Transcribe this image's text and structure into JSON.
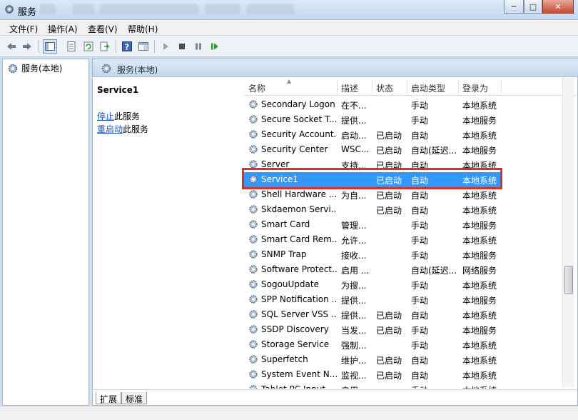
{
  "window": {
    "title": "服务",
    "controls": {
      "minimize": "─",
      "maximize": "□",
      "close": "✕"
    }
  },
  "menu": [
    "文件(F)",
    "操作(A)",
    "查看(V)",
    "帮助(H)"
  ],
  "toolbar": {
    "icons": [
      "back-icon",
      "forward-icon",
      "show-tree-icon",
      "properties-icon",
      "refresh-icon",
      "export-icon",
      "help-icon",
      "view-icon",
      "start-service-icon",
      "stop-service-icon",
      "pause-service-icon",
      "restart-service-icon"
    ]
  },
  "tree": {
    "root_label": "服务(本地)"
  },
  "panel": {
    "header": "服务(本地)",
    "selected_title": "Service1",
    "stop_link": "停止",
    "stop_suffix": "此服务",
    "restart_link": "重启动",
    "restart_suffix": "此服务"
  },
  "columns": [
    "名称",
    "描述",
    "状态",
    "启动类型",
    "登录为"
  ],
  "rows": [
    [
      "Secondary Logon",
      "在不...",
      "",
      "手动",
      "本地系统"
    ],
    [
      "Secure Socket T...",
      "提供...",
      "",
      "手动",
      "本地服务"
    ],
    [
      "Security Account...",
      "启动...",
      "已启动",
      "自动",
      "本地系统"
    ],
    [
      "Security Center",
      "WSC...",
      "已启动",
      "自动(延迟...",
      "本地服务"
    ],
    [
      "Server",
      "支持...",
      "已启动",
      "自动",
      "本地系统"
    ],
    [
      "Service1",
      "",
      "已启动",
      "自动",
      "本地系统"
    ],
    [
      "Shell Hardware ...",
      "为自...",
      "已启动",
      "自动",
      "本地系统"
    ],
    [
      "Skdaemon Servi...",
      "",
      "已启动",
      "自动",
      "本地系统"
    ],
    [
      "Smart Card",
      "管理...",
      "",
      "手动",
      "本地服务"
    ],
    [
      "Smart Card Rem...",
      "允许...",
      "",
      "手动",
      "本地系统"
    ],
    [
      "SNMP Trap",
      "接收...",
      "",
      "手动",
      "本地服务"
    ],
    [
      "Software Protect...",
      "启用 ...",
      "",
      "自动(延迟...",
      "网络服务"
    ],
    [
      "SogouUpdate",
      "为搜...",
      "",
      "手动",
      "本地系统"
    ],
    [
      "SPP Notification ...",
      "提供...",
      "",
      "手动",
      "本地服务"
    ],
    [
      "SQL Server VSS ...",
      "提供...",
      "已启动",
      "自动",
      "本地系统"
    ],
    [
      "SSDP Discovery",
      "当发...",
      "已启动",
      "手动",
      "本地服务"
    ],
    [
      "Storage Service",
      "强制...",
      "",
      "手动",
      "本地系统"
    ],
    [
      "Superfetch",
      "维护...",
      "已启动",
      "自动",
      "本地系统"
    ],
    [
      "System Event N...",
      "监视...",
      "已启动",
      "自动",
      "本地系统"
    ],
    [
      "Tablet PC Input ...",
      "启用...",
      "",
      "手动",
      "本地系统"
    ]
  ],
  "selected_row": 5,
  "tabs": [
    "扩展",
    "标准"
  ],
  "colors": {
    "selection": "#3399ff",
    "highlight_border": "#d9302a",
    "link": "#1a4fc4"
  }
}
